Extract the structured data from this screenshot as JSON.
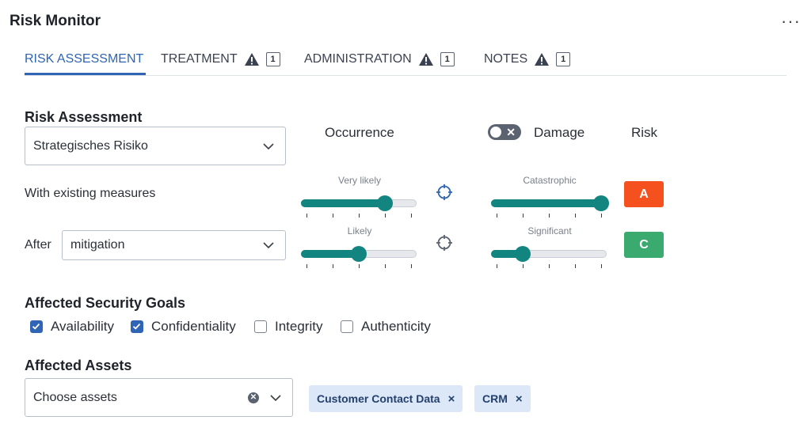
{
  "app": {
    "title": "Risk Monitor",
    "more_label": "···"
  },
  "tabs": [
    {
      "label": "RISK ASSESSMENT",
      "active": true
    },
    {
      "label": "TREATMENT",
      "icon": "warning-icon",
      "count": "1"
    },
    {
      "label": "ADMINISTRATION",
      "icon": "warning-icon",
      "count": "1"
    },
    {
      "label": "NOTES",
      "icon": "warning-icon",
      "count": "1"
    }
  ],
  "risk_assessment": {
    "title": "Risk Assessment",
    "risk_type_value": "Strategisches Risiko",
    "columns": {
      "occurrence": "Occurrence",
      "damage": "Damage",
      "risk": "Risk"
    },
    "damage_toggle_on": false,
    "rows": [
      {
        "label": "With existing measures",
        "occurrence_label": "Very likely",
        "occurrence_level": 0.75,
        "damage_label": "Catastrophic",
        "damage_level": 1.0,
        "risk": "A",
        "risk_color": "#f4511e"
      },
      {
        "label": "After",
        "select_value": "mitigation",
        "occurrence_label": "Likely",
        "occurrence_level": 0.5,
        "damage_label": "Significant",
        "damage_level": 0.25,
        "risk": "C",
        "risk_color": "#3aaa6f"
      }
    ]
  },
  "security_goals": {
    "title": "Affected Security Goals",
    "items": [
      {
        "label": "Availability",
        "checked": true
      },
      {
        "label": "Confidentiality",
        "checked": true
      },
      {
        "label": "Integrity",
        "checked": false
      },
      {
        "label": "Authenticity",
        "checked": false
      }
    ]
  },
  "assets": {
    "title": "Affected Assets",
    "placeholder": "Choose assets",
    "tags": [
      {
        "label": "Customer Contact Data",
        "remove": "×"
      },
      {
        "label": "CRM",
        "remove": "×"
      }
    ]
  },
  "colors": {
    "accent": "#2f65b4",
    "slider": "#138581"
  }
}
